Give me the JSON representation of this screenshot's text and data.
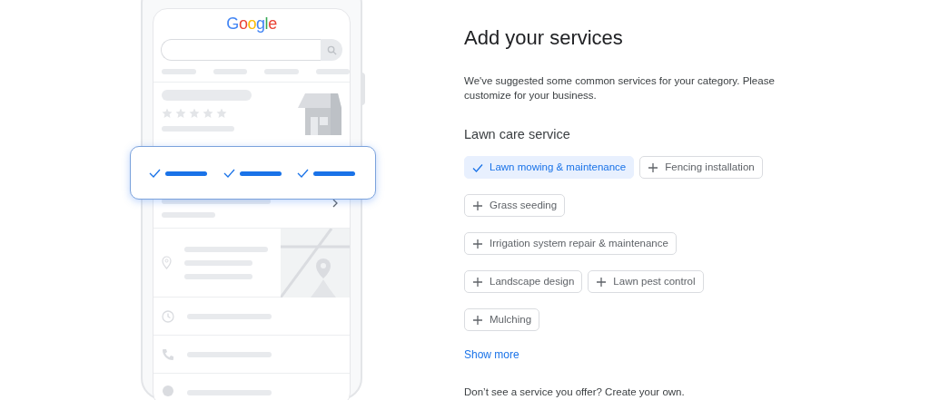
{
  "phone_preview": {
    "logo": "Google"
  },
  "title": "Add your services",
  "description": "We've suggested some common services for your category. Please customize for your business.",
  "category": "Lawn care service",
  "services": [
    {
      "label": "Lawn mowing & maintenance",
      "selected": true
    },
    {
      "label": "Fencing installation",
      "selected": false
    },
    {
      "label": "Grass seeding",
      "selected": false
    },
    {
      "label": "Irrigation system repair & maintenance",
      "selected": false
    },
    {
      "label": "Landscape design",
      "selected": false
    },
    {
      "label": "Lawn pest control",
      "selected": false
    },
    {
      "label": "Mulching",
      "selected": false
    }
  ],
  "show_more": "Show more",
  "footer_text": "Don’t see a service you offer? Create your own."
}
